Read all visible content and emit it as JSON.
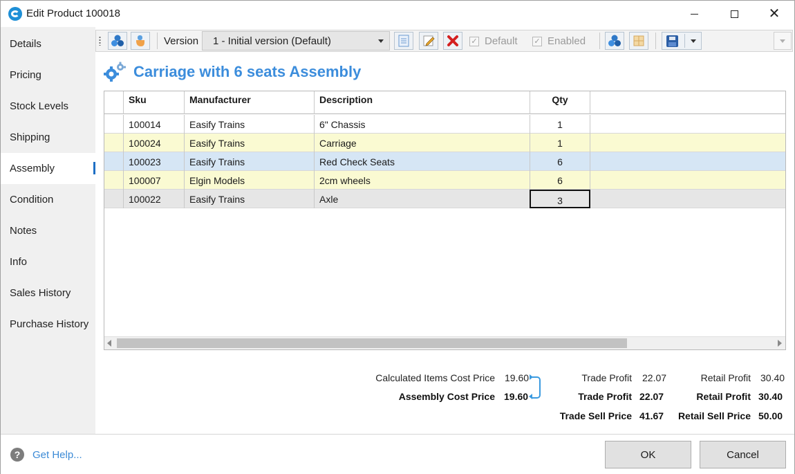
{
  "window": {
    "title": "Edit Product 100018"
  },
  "sidebar": {
    "items": [
      {
        "label": "Details"
      },
      {
        "label": "Pricing"
      },
      {
        "label": "Stock Levels"
      },
      {
        "label": "Shipping"
      },
      {
        "label": "Assembly",
        "active": true
      },
      {
        "label": "Condition"
      },
      {
        "label": "Notes"
      },
      {
        "label": "Info"
      },
      {
        "label": "Sales History"
      },
      {
        "label": "Purchase History"
      }
    ]
  },
  "toolbar": {
    "version_label": "Version",
    "version_value": "1 - Initial version (Default)",
    "default_label": "Default",
    "default_checked": true,
    "enabled_label": "Enabled",
    "enabled_checked": true
  },
  "assembly": {
    "title": "Carriage with 6 seats Assembly",
    "columns": [
      "Sku",
      "Manufacturer",
      "Description",
      "Qty"
    ],
    "rows": [
      {
        "sku": "100014",
        "manufacturer": "Easify Trains",
        "description": "6\" Chassis",
        "qty": "1",
        "color": "#ffffff"
      },
      {
        "sku": "100024",
        "manufacturer": "Easify Trains",
        "description": "Carriage",
        "qty": "1",
        "color": "#fafad2"
      },
      {
        "sku": "100023",
        "manufacturer": "Easify Trains",
        "description": "Red Check Seats",
        "qty": "6",
        "color": "#d6e6f5"
      },
      {
        "sku": "100007",
        "manufacturer": "Elgin Models",
        "description": "2cm wheels",
        "qty": "6",
        "color": "#fafad2"
      },
      {
        "sku": "100022",
        "manufacturer": "Easify Trains",
        "description": "Axle",
        "qty": "3",
        "color": "#e6e6e6"
      }
    ]
  },
  "summary": {
    "calc_items_cost_label": "Calculated Items Cost Price",
    "calc_items_cost_value": "19.60",
    "assembly_cost_label": "Assembly Cost Price",
    "assembly_cost_value": "19.60",
    "trade_profit_label": "Trade Profit",
    "trade_profit_value": "22.07",
    "trade_profit_bold_label": "Trade Profit",
    "trade_profit_bold_value": "22.07",
    "trade_sell_label": "Trade Sell Price",
    "trade_sell_value": "41.67",
    "retail_profit_label": "Retail Profit",
    "retail_profit_value": "30.40",
    "retail_profit_bold_label": "Retail Profit",
    "retail_profit_bold_value": "30.40",
    "retail_sell_label": "Retail Sell Price",
    "retail_sell_value": "50.00"
  },
  "footer": {
    "help_label": "Get Help...",
    "ok_label": "OK",
    "cancel_label": "Cancel"
  },
  "colors": {
    "accent": "#3c8ddc",
    "link": "#3b8ad6",
    "row_yellow": "#fafad2",
    "row_blue": "#d6e6f5"
  }
}
